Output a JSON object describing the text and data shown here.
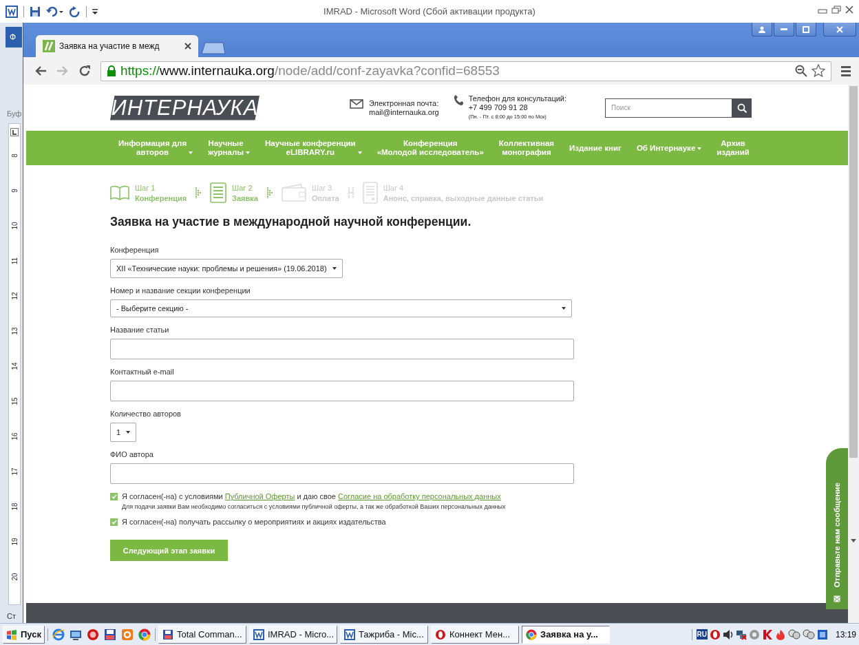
{
  "word": {
    "title": "IMRAD  -  Microsoft Word (Сбой активации продукта)",
    "file_tab": "Ф",
    "side_label": "Буф",
    "ruler_marks": [
      "8",
      "9",
      "10",
      "11",
      "12",
      "13",
      "14",
      "15",
      "16",
      "17",
      "18",
      "19",
      "20"
    ],
    "status_text": "Ст"
  },
  "browser": {
    "tab_title": "Заявка на участие в межд",
    "url": {
      "scheme": "https://",
      "host": "www.internauka.org",
      "path": "/node/add/conf-zayavka?confid=68553"
    }
  },
  "site": {
    "logo": "ИНТЕРНАУКА",
    "email_label": "Электронная почта:",
    "email": "mail@internauka.org",
    "phone_label": "Телефон для консультаций:",
    "phone": "+7 499 709 91 28",
    "phone_hours": "(Пн. - Пт. с 8:00 до 15:00 по Мск)",
    "search_placeholder": "Поиск",
    "nav": [
      {
        "label": "Информация для\nавторов",
        "dropdown": true
      },
      {
        "label": "Научные\nжурналы",
        "dropdown": true
      },
      {
        "label": "Научные конференции\neLIBRARY.ru",
        "dropdown": true
      },
      {
        "label": "Конференция\n«Молодой исследователь»",
        "dropdown": false
      },
      {
        "label": "Коллективная\nмонография",
        "dropdown": false
      },
      {
        "label": "Издание книг",
        "dropdown": false
      },
      {
        "label": "Об Интернауке",
        "dropdown": true
      },
      {
        "label": "Архив\nизданий",
        "dropdown": false
      }
    ],
    "steps": [
      {
        "kind": "book",
        "step": "Шаг 1",
        "name": "Конференция",
        "active": true
      },
      {
        "kind": "form",
        "step": "Шаг 2",
        "name": "Заявка",
        "active": true
      },
      {
        "kind": "wallet",
        "step": "Шаг 3",
        "name": "Оплата",
        "active": false
      },
      {
        "kind": "document",
        "step": "Шаг 4",
        "name": "Анонс, справка, выходные данные статьи",
        "active": false
      }
    ],
    "form": {
      "title": "Заявка на участие в международной научной конференции.",
      "fields": [
        {
          "kind": "select",
          "label": "Конференция",
          "value": "XII «Технические науки: проблемы и решения» (19.06.2018)"
        },
        {
          "kind": "wide-select",
          "label": "Номер и название секции конференции",
          "value": "- Выберите секцию -"
        },
        {
          "kind": "input",
          "label": "Название статьи"
        },
        {
          "kind": "input",
          "label": "Контактный e-mail"
        },
        {
          "kind": "select",
          "label": "Количество авторов",
          "value": "1"
        },
        {
          "kind": "input",
          "label": "ФИО автора"
        }
      ],
      "agreements": [
        {
          "checked": true,
          "segments": [
            {
              "text": "Я согласен(-на) с условиями ",
              "kind": "text"
            },
            {
              "text": "Публичной Оферты",
              "kind": "link"
            },
            {
              "text": " и даю свое ",
              "kind": "text"
            },
            {
              "text": "Согласие на обработку персональных данных",
              "kind": "link"
            }
          ],
          "note": "Для подачи заявки Вам необходимо согласиться с условиями публичной оферты, а так же обработкой Ваших персональных данных"
        },
        {
          "checked": true,
          "segments": [
            {
              "text": "Я согласен(-на) получать рассылку о мероприятиях и акциях издательства",
              "kind": "text"
            }
          ]
        }
      ],
      "submit": "Следующий этап заявки"
    },
    "feedback": "Отправьте нам сообщение"
  },
  "taskbar": {
    "start": "Пуск",
    "tasks": [
      {
        "kind": "commander",
        "label": "Total Comman...",
        "selected": false
      },
      {
        "kind": "word",
        "label": "IMRAD - Micro...",
        "selected": false
      },
      {
        "kind": "word",
        "label": "Тажриба - Mic...",
        "selected": false
      },
      {
        "kind": "opera",
        "label": "Коннект Мен...",
        "selected": false
      },
      {
        "kind": "chrome",
        "label": "Заявка на у...",
        "selected": true
      }
    ],
    "language": "RU",
    "clock": "13:19"
  }
}
